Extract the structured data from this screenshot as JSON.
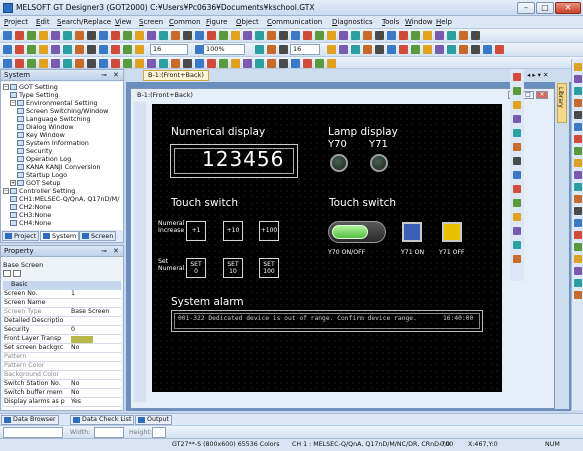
{
  "window": {
    "title": "MELSOFT GT Designer3 (GOT2000) C:¥Users¥Pc0636¥Documents¥kschool.GTX",
    "minimize": "–",
    "maximize": "□",
    "close": "✕"
  },
  "menu": [
    "Project",
    "Edit",
    "Search/Replace",
    "View",
    "Screen",
    "Common",
    "Figure",
    "Object",
    "Communication",
    "Diagnostics",
    "Tools",
    "Window",
    "Help"
  ],
  "toolbar": {
    "font_size": "16",
    "zoom": "100%",
    "font_size2": "16"
  },
  "system_panel": {
    "title": "System",
    "tree": [
      {
        "label": "GOT Setting",
        "level": 0,
        "expander": "−"
      },
      {
        "label": "Type Setting",
        "level": 1
      },
      {
        "label": "Environmental Setting",
        "level": 1,
        "expander": "−"
      },
      {
        "label": "Screen Switching/Window",
        "level": 2
      },
      {
        "label": "Language Switching",
        "level": 2
      },
      {
        "label": "Dialog Window",
        "level": 2
      },
      {
        "label": "Key Window",
        "level": 2
      },
      {
        "label": "System Information",
        "level": 2
      },
      {
        "label": "Security",
        "level": 2
      },
      {
        "label": "Operation Log",
        "level": 2
      },
      {
        "label": "KANA KANJI Conversion",
        "level": 2
      },
      {
        "label": "Startup Logo",
        "level": 2
      },
      {
        "label": "GOT Setup",
        "level": 1,
        "expander": "+"
      },
      {
        "label": "Controller Setting",
        "level": 0,
        "expander": "−"
      },
      {
        "label": "CH1:MELSEC-Q/QnA, Q17nD/M/",
        "level": 1
      },
      {
        "label": "CH2:None",
        "level": 1
      },
      {
        "label": "CH3:None",
        "level": 1
      },
      {
        "label": "CH4:None",
        "level": 1
      }
    ],
    "tabs": [
      "Project",
      "System",
      "Screen"
    ]
  },
  "property_panel": {
    "title": "Property",
    "subtitle": "Base Screen",
    "section": "Basic",
    "rows": [
      {
        "key": "Screen No.",
        "value": "1",
        "gray": false
      },
      {
        "key": "Screen Name",
        "value": "",
        "gray": false
      },
      {
        "key": "Screen Type",
        "value": "Base Screen",
        "gray": true
      },
      {
        "key": "Detailed Descriptio",
        "value": "",
        "gray": false
      },
      {
        "key": "Security",
        "value": "0",
        "gray": false
      },
      {
        "key": "Front Layer Transp",
        "value": "",
        "gray": false,
        "swatch": "#b8b84a"
      },
      {
        "key": "Set screen backgrc",
        "value": "No",
        "gray": false
      },
      {
        "key": "Pattern",
        "value": "",
        "gray": true
      },
      {
        "key": "Pattern Color",
        "value": "",
        "gray": true
      },
      {
        "key": "Background Color",
        "value": "",
        "gray": true
      },
      {
        "key": "Switch Station No.",
        "value": "No",
        "gray": false
      },
      {
        "key": "Switch buffer mem",
        "value": "No",
        "gray": false
      },
      {
        "key": "Display alarms as p",
        "value": "Yes",
        "gray": false
      }
    ]
  },
  "editor": {
    "doc_tab": "B-1:(Front+Back)",
    "subwindow_title": "B-1:(Front+Back)",
    "right_label": "Library",
    "arrows": "◂ ▸ ▾ ✕"
  },
  "screen": {
    "numerical_title": "Numerical display",
    "numerical_value": "123456",
    "lamp_title": "Lamp display",
    "lamp_labels": [
      "Y70",
      "Y71"
    ],
    "touch_title_left": "Touch switch",
    "touch_title_right": "Touch switch",
    "numeral_increase_label": [
      "Numeral",
      "Increase"
    ],
    "increase_buttons": [
      "+1",
      "+10",
      "+100"
    ],
    "set_numeral_label": [
      "Set",
      "Numeral"
    ],
    "set_buttons": [
      [
        "SET",
        "0"
      ],
      [
        "SET",
        "10"
      ],
      [
        "SET",
        "100"
      ]
    ],
    "switch_labels": [
      "Y70 ON/OFF",
      "Y71 ON",
      "Y71 OFF"
    ],
    "alarm_title": "System alarm",
    "alarm_text": "001-322 Dedicated device is out of range. Confirm device range.",
    "alarm_time": "16:40:00"
  },
  "colors": {
    "lamp_on_switch": "#7dd66a",
    "y71_on": "#3a5fb8",
    "y71_off": "#e8c000",
    "screen_bg": "#000000"
  },
  "bottom_tabs": [
    "Data Browser",
    "Data Check List",
    "Output"
  ],
  "bottom_toolbar": {
    "width_label": "Width:",
    "height_label": "Height:"
  },
  "status": {
    "model": "GT27**-S (800x600) 65536 Colors",
    "channel": "CH 1 : MELSEC-Q/QnA, Q17nD/M/NC/DR, CRnD-700",
    "pos": "0,0",
    "cursor": "X:467,Y:0",
    "num": "NUM"
  }
}
